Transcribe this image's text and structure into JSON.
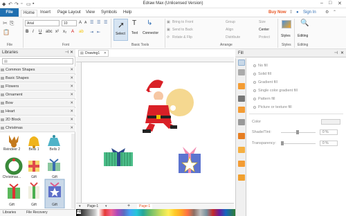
{
  "window": {
    "title": "Edraw Max (Unlicensed Version)",
    "buy_now": "Buy Now",
    "sign_in": "Sign In"
  },
  "menu": {
    "file": "File",
    "items": [
      "Home",
      "Insert",
      "Page Layout",
      "View",
      "Symbols",
      "Help"
    ]
  },
  "ribbon": {
    "font_name": "Arial",
    "font_size": "10",
    "groups": [
      "File",
      "Font",
      "Basic Tools",
      "Arrange",
      "Styles",
      "Editing"
    ],
    "basic_tools": [
      "Select",
      "Text",
      "Connector"
    ],
    "arrange": [
      "Bring to Front",
      "Send to Back",
      "Rotate & Flip",
      "Group",
      "Align",
      "Distribute",
      "Size",
      "Center",
      "Protect"
    ],
    "styles_label": "Styles",
    "editing_label": "Editing"
  },
  "libraries": {
    "title": "Libraries",
    "categories": [
      "Common Shapes",
      "Basic Shapes",
      "Flowers",
      "Ornament",
      "Bow",
      "Heart",
      "2D Block",
      "Christmas"
    ],
    "shapes": [
      "Reindeer 2",
      "Bells 1",
      "Bells 2",
      "Christmas...",
      "Gift",
      "Gift",
      "Gift",
      "Gift",
      "Gift"
    ],
    "bottom_tabs": [
      "Libraries",
      "File Recovery"
    ]
  },
  "document": {
    "tab": "Drawing1",
    "page_tab": "Page-1",
    "page_add": "+",
    "page_active": "Page-1"
  },
  "fill": {
    "title": "Fill",
    "options": [
      "No fill",
      "Solid fill",
      "Gradient fill",
      "Single color gradient fill",
      "Pattern fill",
      "Picture or texture fill"
    ],
    "color_label": "Color",
    "shade_label": "Shade/Tint:",
    "shade_value": "0 %",
    "transparency_label": "Transparency:",
    "transparency_value": "0 %"
  },
  "palette_label": "Fill",
  "colors": {
    "accent": "#1f6fb0",
    "buy": "#e8531f"
  }
}
